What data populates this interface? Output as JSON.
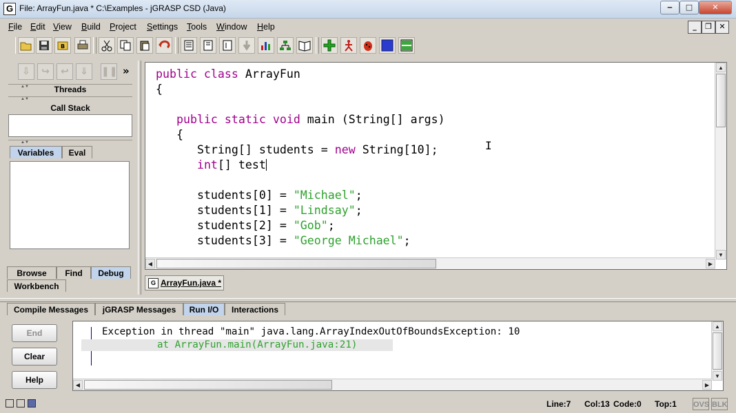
{
  "window": {
    "title": "File: ArrayFun.java *  C:\\Examples - jGRASP CSD (Java)",
    "app_icon_letter": "G"
  },
  "menu": [
    "File",
    "Edit",
    "View",
    "Build",
    "Project",
    "Settings",
    "Tools",
    "Window",
    "Help"
  ],
  "toolbar_icons": [
    "open-icon",
    "save-icon",
    "open-project-icon",
    "print-icon",
    "cut-icon",
    "copy-icon",
    "paste-icon",
    "undo-icon",
    "generate-csd-icon",
    "remove-csd-icon",
    "fold-icon",
    "unfold-icon",
    "number-lines-icon",
    "uml-icon",
    "browse-icon",
    "compile-icon",
    "run-icon",
    "debug-icon",
    "stop-icon",
    "split-view-icon"
  ],
  "debug_panel": {
    "threads_label": "Threads",
    "call_stack_label": "Call Stack",
    "tabs": [
      "Variables",
      "Eval"
    ]
  },
  "left_tabs": [
    "Browse",
    "Find",
    "Debug",
    "Workbench"
  ],
  "editor": {
    "file_tab": "ArrayFun.java *",
    "lines": [
      [
        {
          "t": "public class",
          "c": "kw"
        },
        {
          "t": " ArrayFun"
        }
      ],
      [
        {
          "t": "{"
        }
      ],
      [
        {
          "t": ""
        }
      ],
      [
        {
          "t": "   "
        },
        {
          "t": "public static void",
          "c": "kw"
        },
        {
          "t": " main (String[] args)"
        }
      ],
      [
        {
          "t": "   {"
        }
      ],
      [
        {
          "t": "      String[] students = "
        },
        {
          "t": "new",
          "c": "kw"
        },
        {
          "t": " String[10];"
        }
      ],
      [
        {
          "t": "      "
        },
        {
          "t": "int",
          "c": "kw"
        },
        {
          "t": "[] test"
        }
      ],
      [
        {
          "t": ""
        }
      ],
      [
        {
          "t": "      students[0] = "
        },
        {
          "t": "\"Michael\"",
          "c": "str"
        },
        {
          "t": ";"
        }
      ],
      [
        {
          "t": "      students[1] = "
        },
        {
          "t": "\"Lindsay\"",
          "c": "str"
        },
        {
          "t": ";"
        }
      ],
      [
        {
          "t": "      students[2] = "
        },
        {
          "t": "\"Gob\"",
          "c": "str"
        },
        {
          "t": ";"
        }
      ],
      [
        {
          "t": "      students[3] = "
        },
        {
          "t": "\"George Michael\"",
          "c": "str"
        },
        {
          "t": ";"
        }
      ]
    ]
  },
  "bottom_tabs": [
    "Compile Messages",
    "jGRASP Messages",
    "Run I/O",
    "Interactions"
  ],
  "run_io": {
    "line1": "Exception in thread \"main\" java.lang.ArrayIndexOutOfBoundsException: 10",
    "line2": "at ArrayFun.main(ArrayFun.java:21)",
    "buttons": {
      "end": "End",
      "clear": "Clear",
      "help": "Help"
    }
  },
  "status": {
    "line": "Line:7",
    "col": "Col:13",
    "code": "Code:0",
    "top": "Top:1",
    "ovs": "OVS",
    "blk": "BLK"
  },
  "colors": {
    "keyword": "#a0008c",
    "string": "#2ea12e",
    "active_tab": "#c2d4ec",
    "window_bg": "#d4d0c8"
  }
}
